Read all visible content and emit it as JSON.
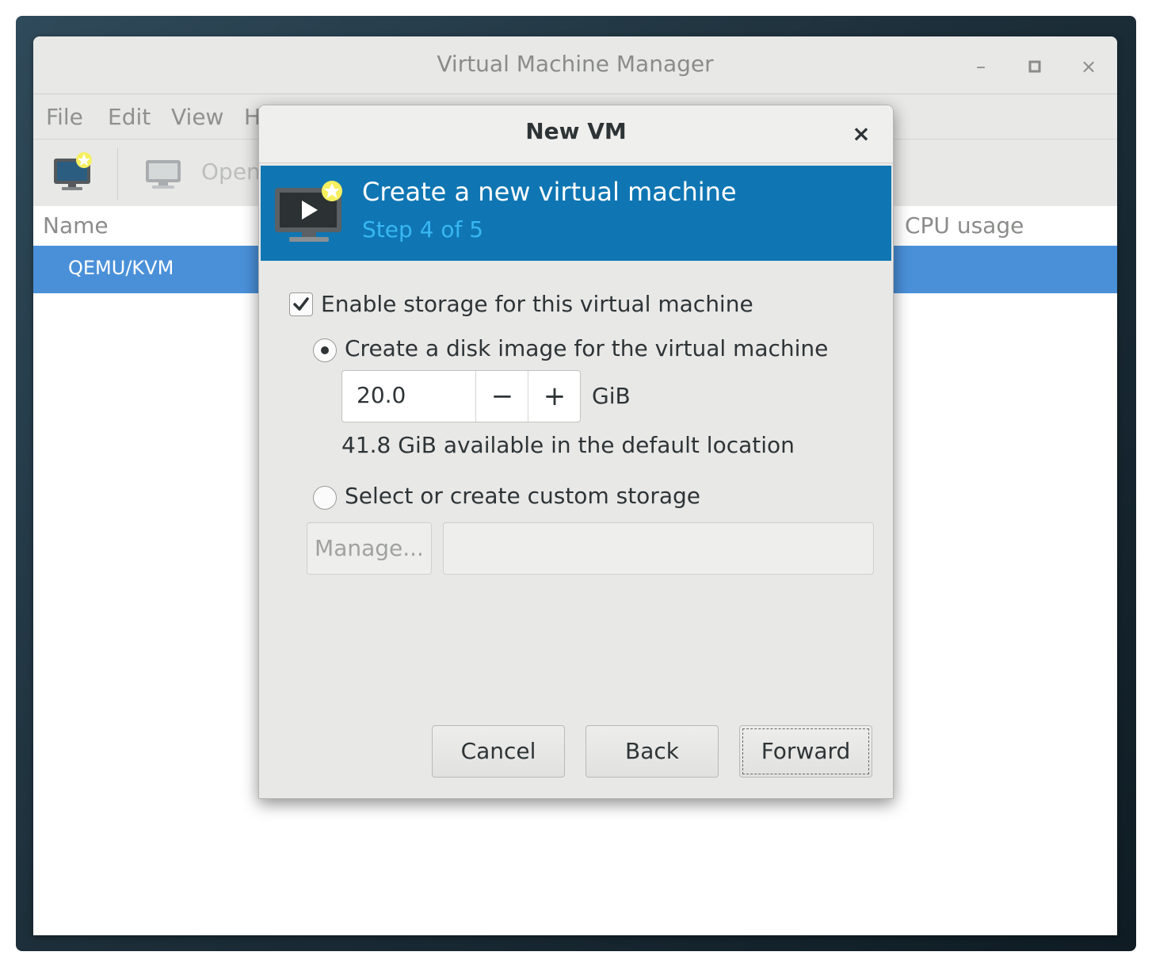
{
  "window": {
    "title": "Virtual Machine Manager",
    "controls": {
      "minimize": "–",
      "maximize": "□",
      "close": "×"
    }
  },
  "menubar": {
    "items": [
      "File",
      "Edit",
      "View",
      "H"
    ]
  },
  "toolbar": {
    "open_label": "Open"
  },
  "list": {
    "columns": {
      "name": "Name",
      "cpu": "CPU usage"
    },
    "rows": [
      {
        "label": "QEMU/KVM",
        "selected": true
      }
    ]
  },
  "dialog": {
    "title": "New VM",
    "close": "×",
    "banner": {
      "title": "Create a new virtual machine",
      "step": "Step 4 of 5"
    },
    "storage": {
      "enable_label": "Enable storage for this virtual machine",
      "enable_checked": true,
      "option_create_label": "Create a disk image for the virtual machine",
      "option_create_selected": true,
      "size_value": "20.0",
      "minus": "−",
      "plus": "+",
      "unit": "GiB",
      "available_text": "41.8 GiB available in the default location",
      "option_custom_label": "Select or create custom storage",
      "manage_label": "Manage...",
      "path_value": ""
    },
    "buttons": {
      "cancel": "Cancel",
      "back": "Back",
      "forward": "Forward"
    }
  },
  "colors": {
    "banner_bg": "#0f76b3",
    "banner_step": "#38b7f2",
    "selection": "#4a90d9"
  }
}
